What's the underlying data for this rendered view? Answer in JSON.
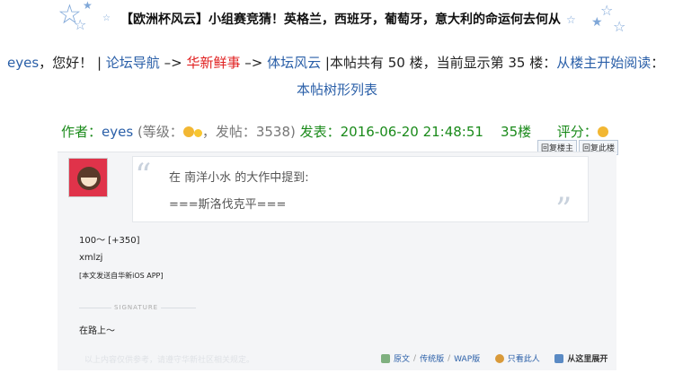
{
  "title": "【欧洲杯风云】小组赛竞猜！英格兰，西班牙，葡萄牙，意大利的命运何去何从",
  "nav": {
    "username": "eyes",
    "greeting": "，您好！",
    "sep1": "|",
    "forum_nav": "论坛导航",
    "arrow1": "–>",
    "board": "华新鲜事",
    "arrow2": "–>",
    "section": "体坛风云",
    "sep2": "|",
    "summary": "本帖共有 50 楼，当前显示第 35 楼：",
    "read_from_op": "从楼主开始阅读",
    "trail": "：",
    "tree_list": "本帖树形列表"
  },
  "post": {
    "author_label": "作者：",
    "author": "eyes",
    "level_open": "(等级：",
    "level_close": "，发帖：3538)",
    "posted_label": "发表：",
    "datetime": "2016-06-20 21:48:51",
    "floor": "35楼",
    "rating_label": "评分：",
    "reply_op": "回复楼主",
    "reply_this": "回复此楼",
    "quote_line1": "在 南洋小水 的大作中提到:",
    "quote_line2": "===斯洛伐克平===",
    "body_line1": "100～ [+350]",
    "body_line2": "xmlzj",
    "body_line3": "[本文发送自华新iOS APP]",
    "signature_label": "SIGNATURE",
    "signature": "在路上～",
    "footer_faint": "以上内容仅供参考，请遵守华新社区相关规定。",
    "link_original": "原文",
    "link_traditional": "传统版",
    "link_wap": "WAP版",
    "link_only_author": "只看此人",
    "link_expand": "从这里展开",
    "slash1": "/",
    "slash2": "/"
  },
  "colors": {
    "link_blue": "#2a5fa8",
    "highlight_red": "#e02020",
    "meta_green": "#1a8a1a",
    "star_blue": "#7fa7d8"
  }
}
